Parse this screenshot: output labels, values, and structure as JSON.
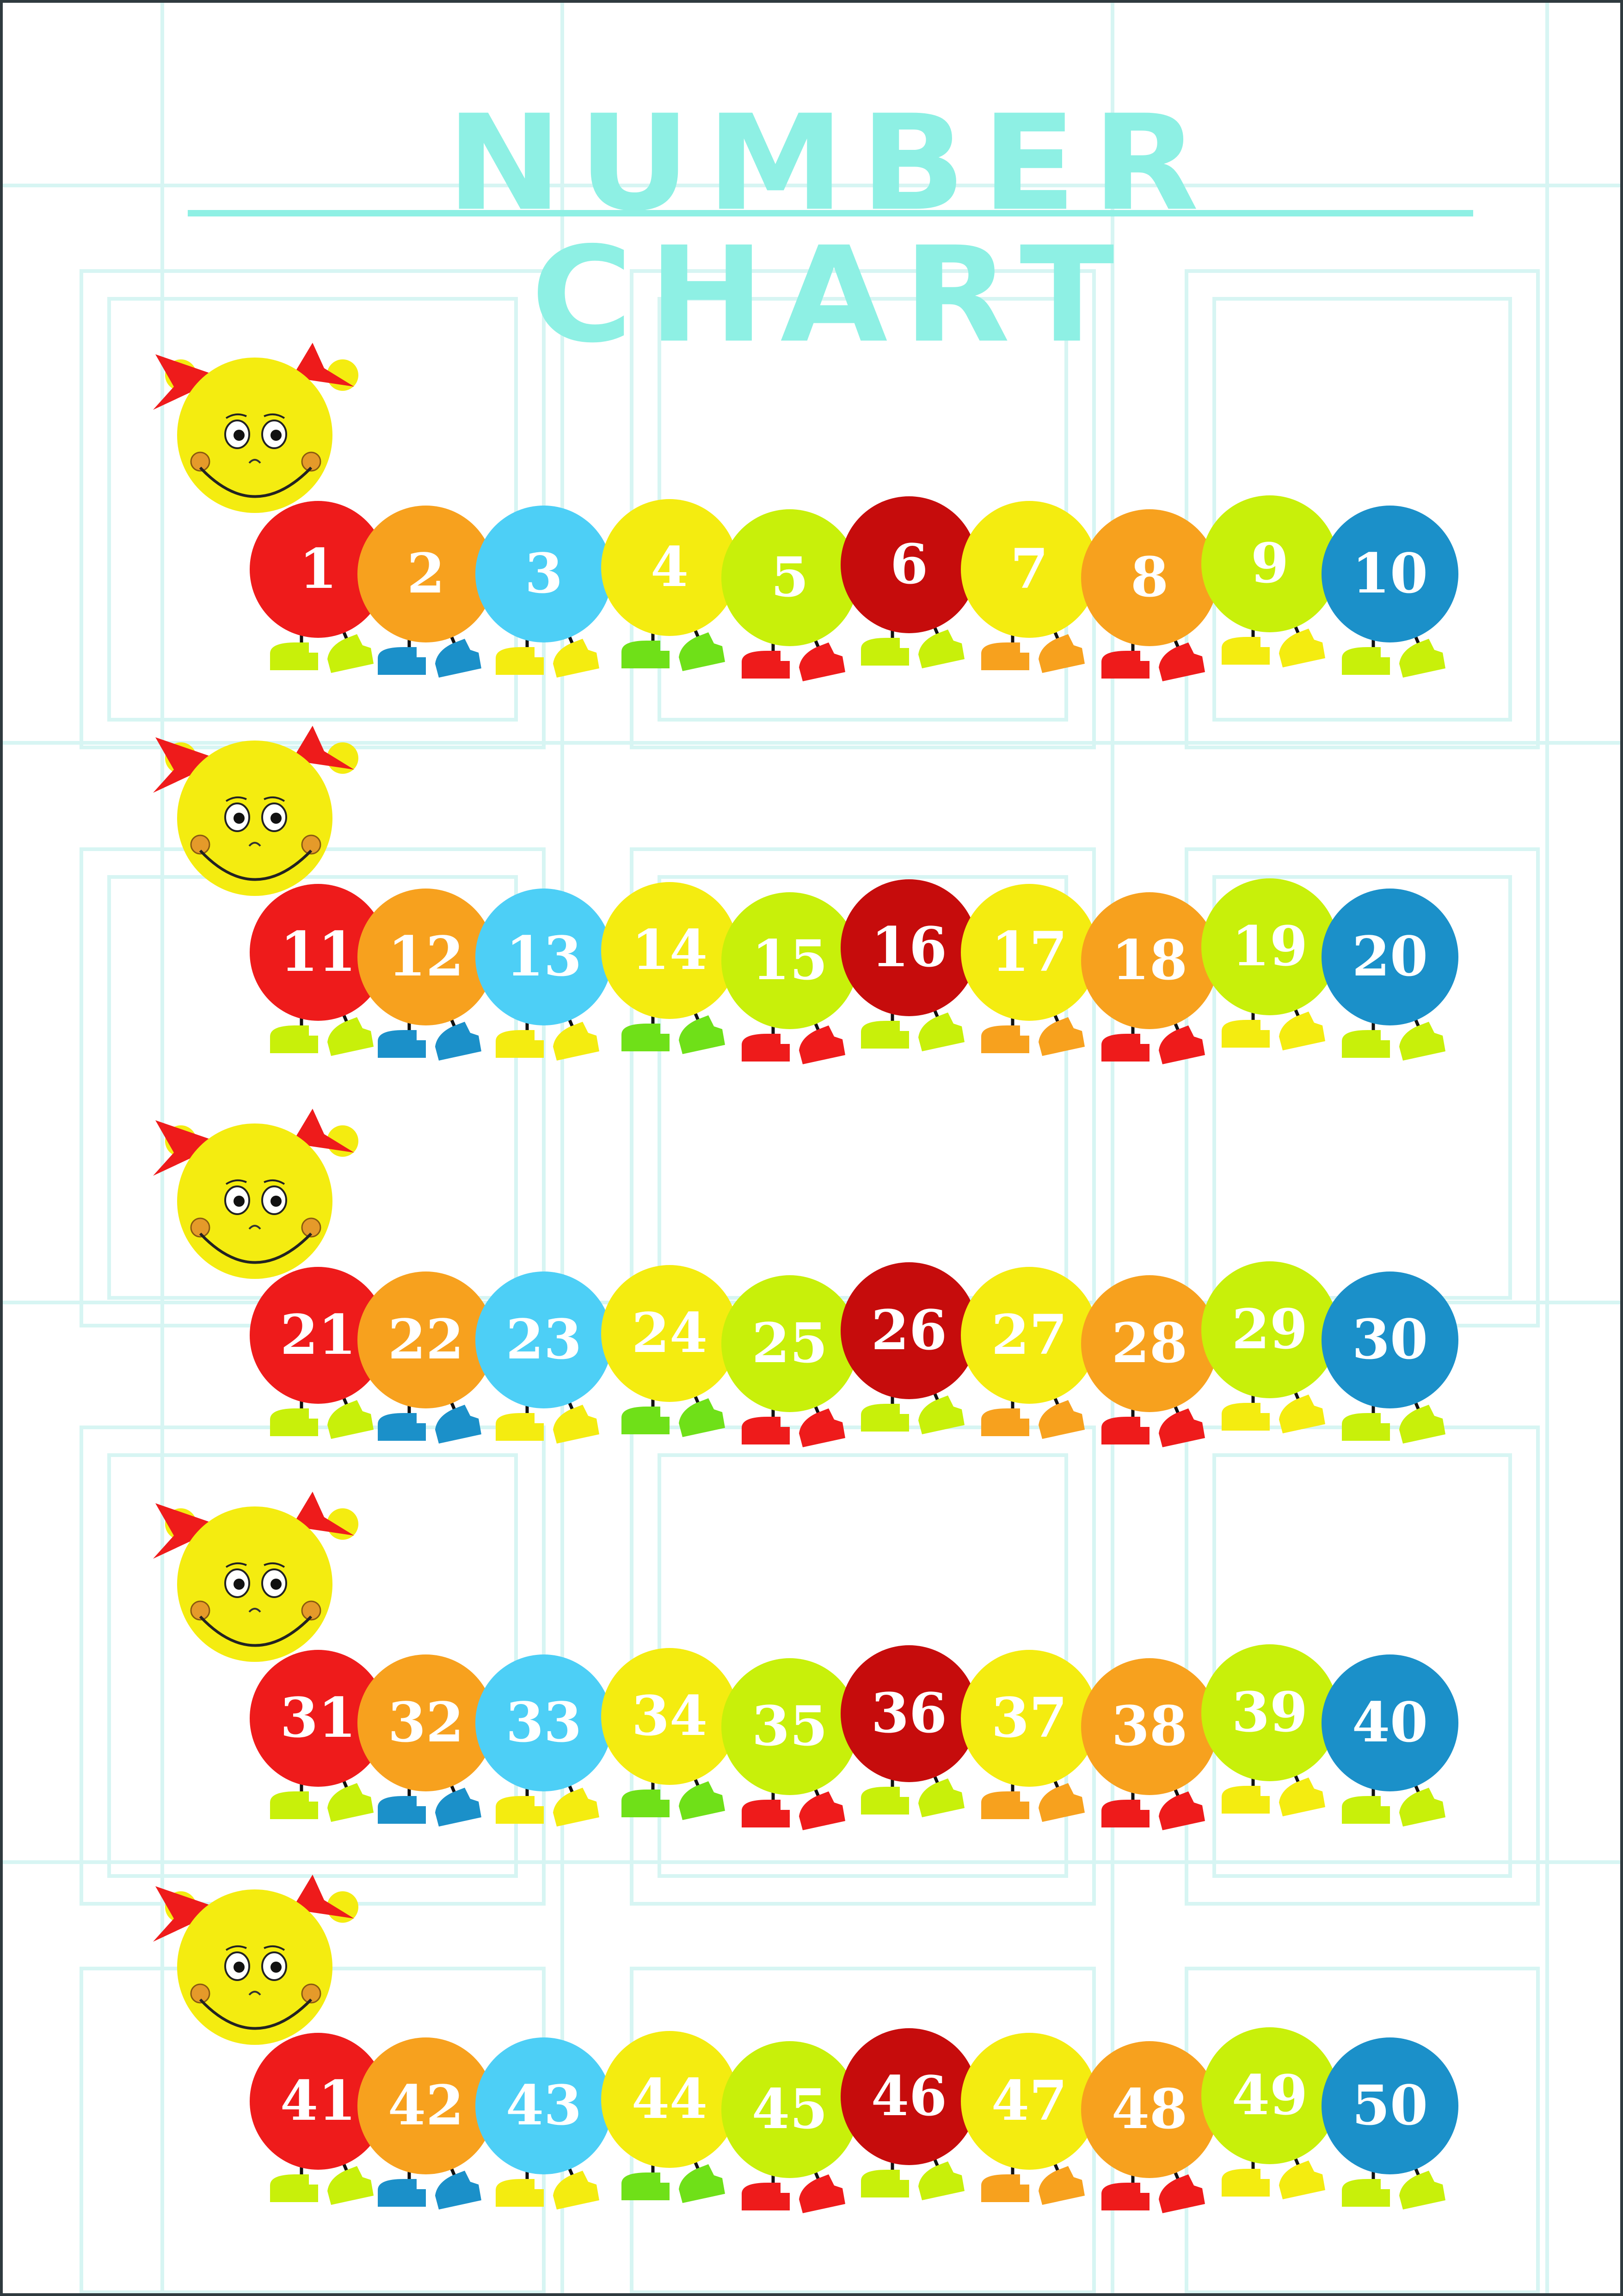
{
  "title": "NUMBER CHART",
  "rows": [
    [
      1,
      2,
      3,
      4,
      5,
      6,
      7,
      8,
      9,
      10
    ],
    [
      11,
      12,
      13,
      14,
      15,
      16,
      17,
      18,
      19,
      20
    ],
    [
      21,
      22,
      23,
      24,
      25,
      26,
      27,
      28,
      29,
      30
    ],
    [
      31,
      32,
      33,
      34,
      35,
      36,
      37,
      38,
      39,
      40
    ],
    [
      41,
      42,
      43,
      44,
      45,
      46,
      47,
      48,
      49,
      50
    ]
  ],
  "colors": {
    "title": "#8ef0e4",
    "maze_lines": "#d7f5f3",
    "head": "#f4ec10",
    "bows": "#ee1b1b",
    "cheeks": "#e59a2a",
    "body_segments": [
      "#ee1b1b",
      "#f7a11e",
      "#4dcff6",
      "#f4ec10",
      "#c8f00a",
      "#c60c0c",
      "#f4ec10",
      "#f7a11e",
      "#c8f00a",
      "#1b90c9"
    ],
    "boot_colors": [
      "#c8f00a",
      "#1b90c9",
      "#f4ec10",
      "#6fe018",
      "#ee1b1b",
      "#c8f00a",
      "#f7a11e",
      "#ee1b1b",
      "#f4ec10",
      "#c8f00a"
    ]
  },
  "icons": {
    "head": "caterpillar-head-icon",
    "bow": "bow-icon",
    "boot": "boot-icon"
  }
}
